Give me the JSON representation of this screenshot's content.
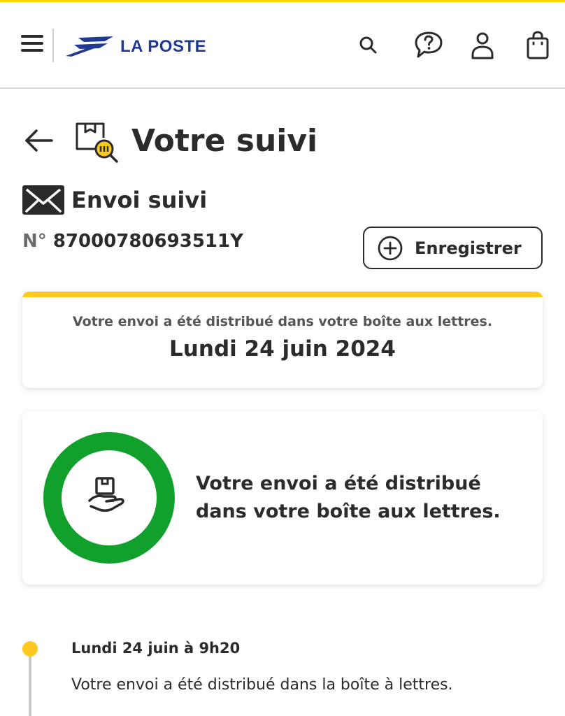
{
  "header": {
    "brand": "LA POSTE",
    "icons": [
      "menu-icon",
      "search-icon",
      "help-icon",
      "account-icon",
      "cart-icon"
    ]
  },
  "page": {
    "title": "Votre suivi"
  },
  "shipment": {
    "type": "Envoi suivi",
    "number_prefix": "N°",
    "number": "87000780693511Y",
    "save_label": "Enregistrer"
  },
  "delivery_summary": {
    "message": "Votre envoi a été distribué dans votre boîte aux lettres.",
    "date": "Lundi 24 juin 2024"
  },
  "status": {
    "text": "Votre envoi a été distribué dans votre boîte aux lettres.",
    "progress": 1.0
  },
  "timeline": [
    {
      "date": "Lundi 24 juin à 9h20",
      "description": "Votre envoi a été distribué dans la boîte à lettres."
    }
  ],
  "colors": {
    "accent_yellow": "#ffc81e",
    "brand_blue": "#1f3a93",
    "status_green": "#12a02c",
    "text_dark": "#2b2b2b"
  }
}
